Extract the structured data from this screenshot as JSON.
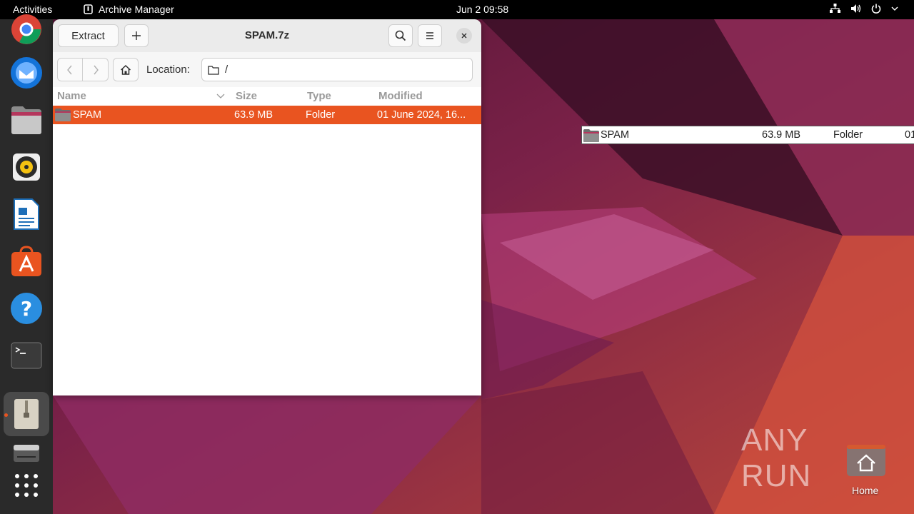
{
  "topbar": {
    "activities": "Activities",
    "app_name": "Archive Manager",
    "clock": "Jun 2  09:58"
  },
  "dock": {
    "items": [
      {
        "name": "chrome"
      },
      {
        "name": "thunderbird"
      },
      {
        "name": "files"
      },
      {
        "name": "rhythmbox"
      },
      {
        "name": "libreoffice-writer"
      },
      {
        "name": "app-center"
      },
      {
        "name": "help"
      },
      {
        "name": "terminal"
      },
      {
        "name": "archive-manager",
        "active": true
      },
      {
        "name": "disks"
      },
      {
        "name": "show-apps"
      }
    ]
  },
  "window": {
    "title": "SPAM.7z",
    "extract_label": "Extract",
    "location_label": "Location:",
    "location_path": "/",
    "columns": {
      "name": "Name",
      "size": "Size",
      "type": "Type",
      "modified": "Modified"
    },
    "rows": [
      {
        "name": "SPAM",
        "size": "63.9 MB",
        "type": "Folder",
        "modified": "01 June 2024, 16..."
      }
    ]
  },
  "drag_ghost": {
    "name": "SPAM",
    "size": "63.9 MB",
    "type": "Folder",
    "modified": "01"
  },
  "desktop": {
    "home_label": "Home",
    "watermark": "ANY RUN"
  },
  "colors": {
    "accent": "#e95420",
    "topbar": "#000000",
    "dock": "#2a2a2a"
  }
}
